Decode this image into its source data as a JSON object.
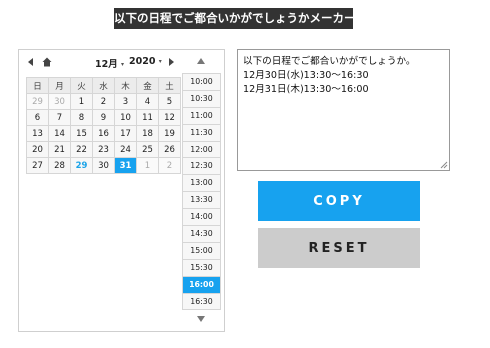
{
  "header": {
    "title": "以下の日程でご都合いかがでしょうかメーカー"
  },
  "calendar": {
    "month": "12月",
    "year": "2020",
    "weekdays": [
      "日",
      "月",
      "火",
      "水",
      "木",
      "金",
      "土"
    ],
    "weeks": [
      [
        "29",
        "30",
        "1",
        "2",
        "3",
        "4",
        "5"
      ],
      [
        "6",
        "7",
        "8",
        "9",
        "10",
        "11",
        "12"
      ],
      [
        "13",
        "14",
        "15",
        "16",
        "17",
        "18",
        "19"
      ],
      [
        "20",
        "21",
        "22",
        "23",
        "24",
        "25",
        "26"
      ],
      [
        "27",
        "28",
        "29",
        "30",
        "31",
        "1",
        "2"
      ]
    ],
    "today": "29",
    "selected": "31"
  },
  "times": {
    "items": [
      "10:00",
      "10:30",
      "11:00",
      "11:30",
      "12:00",
      "12:30",
      "13:00",
      "13:30",
      "14:00",
      "14:30",
      "15:00",
      "15:30",
      "16:00",
      "16:30"
    ],
    "selected": "16:00"
  },
  "output": {
    "lines": [
      "以下の日程でご都合いかがでしょうか。",
      "12月30日(水)13:30〜16:30",
      "12月31日(木)13:30〜16:00"
    ]
  },
  "buttons": {
    "copy": "COPY",
    "reset": "RESET"
  },
  "colors": {
    "accent": "#17a2ef",
    "title_bg": "#333333",
    "reset_bg": "#cccccc"
  }
}
